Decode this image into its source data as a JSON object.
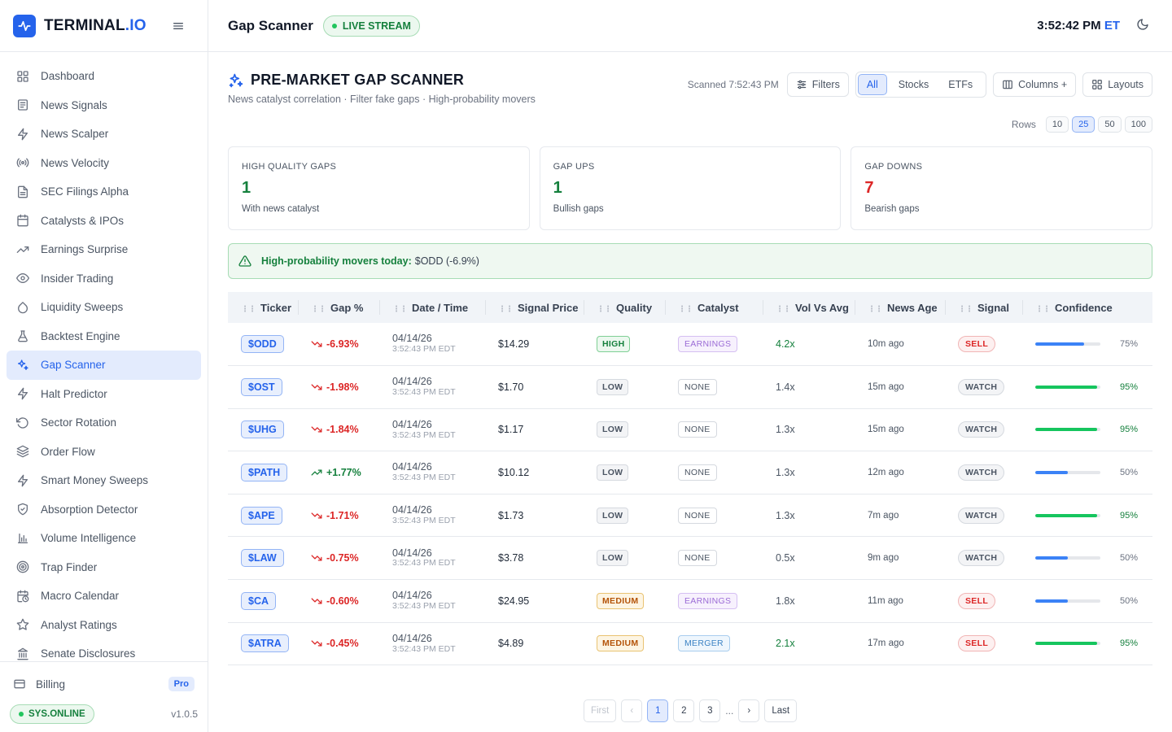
{
  "brand": {
    "name": "TERMINAL",
    "suffix": ".IO"
  },
  "nav": [
    {
      "label": "Dashboard",
      "icon": "dashboard-icon"
    },
    {
      "label": "News Signals",
      "icon": "newspaper-icon"
    },
    {
      "label": "News Scalper",
      "icon": "bolt-icon"
    },
    {
      "label": "News Velocity",
      "icon": "radio-icon"
    },
    {
      "label": "SEC Filings Alpha",
      "icon": "document-icon"
    },
    {
      "label": "Catalysts & IPOs",
      "icon": "calendar-icon"
    },
    {
      "label": "Earnings Surprise",
      "icon": "trending-up-icon"
    },
    {
      "label": "Insider Trading",
      "icon": "eye-icon"
    },
    {
      "label": "Liquidity Sweeps",
      "icon": "droplet-icon"
    },
    {
      "label": "Backtest Engine",
      "icon": "flask-icon"
    },
    {
      "label": "Gap Scanner",
      "icon": "sparkles-icon",
      "active": true
    },
    {
      "label": "Halt Predictor",
      "icon": "bolt-icon"
    },
    {
      "label": "Sector Rotation",
      "icon": "rotate-icon"
    },
    {
      "label": "Order Flow",
      "icon": "layers-icon"
    },
    {
      "label": "Smart Money Sweeps",
      "icon": "bolt-icon"
    },
    {
      "label": "Absorption Detector",
      "icon": "shield-icon"
    },
    {
      "label": "Volume Intelligence",
      "icon": "bar-chart-icon"
    },
    {
      "label": "Trap Finder",
      "icon": "target-icon"
    },
    {
      "label": "Macro Calendar",
      "icon": "calendar-clock-icon"
    },
    {
      "label": "Analyst Ratings",
      "icon": "star-icon"
    },
    {
      "label": "Senate Disclosures",
      "icon": "landmark-icon"
    }
  ],
  "billing": {
    "label": "Billing",
    "badge": "Pro"
  },
  "system": {
    "status": "SYS.ONLINE",
    "version": "v1.0.5"
  },
  "topbar": {
    "title": "Gap Scanner",
    "live": "LIVE STREAM",
    "time": "3:52:42 PM",
    "tz": "ET"
  },
  "page": {
    "title": "PRE-MARKET GAP SCANNER",
    "subtitle": "News catalyst correlation · Filter fake gaps · High-probability movers",
    "scanned": "Scanned 7:52:43 PM",
    "filters_label": "Filters",
    "segments": [
      "All",
      "Stocks",
      "ETFs"
    ],
    "active_segment": "All",
    "columns_label": "Columns +",
    "layouts_label": "Layouts",
    "rows_label": "Rows",
    "rows_options": [
      "10",
      "25",
      "50",
      "100"
    ],
    "rows_selected": "25"
  },
  "cards": [
    {
      "label": "HIGH QUALITY GAPS",
      "value": "1",
      "note": "With news catalyst",
      "tone": "green"
    },
    {
      "label": "GAP UPS",
      "value": "1",
      "note": "Bullish gaps",
      "tone": "green"
    },
    {
      "label": "GAP DOWNS",
      "value": "7",
      "note": "Bearish gaps",
      "tone": "red"
    }
  ],
  "alert": {
    "label": "High-probability movers today:",
    "text": "$ODD (-6.9%)"
  },
  "columns": [
    "Ticker",
    "Gap %",
    "Date / Time",
    "Signal Price",
    "Quality",
    "Catalyst",
    "Vol Vs Avg",
    "News Age",
    "Signal",
    "Confidence"
  ],
  "rows": [
    {
      "ticker": "$ODD",
      "gap": "-6.93%",
      "dir": "down",
      "date": "04/14/26",
      "time": "3:52:43 PM EDT",
      "price": "$14.29",
      "quality": "HIGH",
      "catalyst": "EARNINGS",
      "vol": "4.2x",
      "vol_tone": "green",
      "age": "10m ago",
      "signal": "SELL",
      "confidence": "75%",
      "conf_pct": 0.75,
      "conf_color": "#3b82f6",
      "conf_tone": "#6b7280"
    },
    {
      "ticker": "$OST",
      "gap": "-1.98%",
      "dir": "down",
      "date": "04/14/26",
      "time": "3:52:43 PM EDT",
      "price": "$1.70",
      "quality": "LOW",
      "catalyst": "NONE",
      "vol": "1.4x",
      "vol_tone": "gray",
      "age": "15m ago",
      "signal": "WATCH",
      "confidence": "95%",
      "conf_pct": 0.95,
      "conf_color": "#16c55e",
      "conf_tone": "#15803d"
    },
    {
      "ticker": "$UHG",
      "gap": "-1.84%",
      "dir": "down",
      "date": "04/14/26",
      "time": "3:52:43 PM EDT",
      "price": "$1.17",
      "quality": "LOW",
      "catalyst": "NONE",
      "vol": "1.3x",
      "vol_tone": "gray",
      "age": "15m ago",
      "signal": "WATCH",
      "confidence": "95%",
      "conf_pct": 0.95,
      "conf_color": "#16c55e",
      "conf_tone": "#15803d"
    },
    {
      "ticker": "$PATH",
      "gap": "+1.77%",
      "dir": "up",
      "date": "04/14/26",
      "time": "3:52:43 PM EDT",
      "price": "$10.12",
      "quality": "LOW",
      "catalyst": "NONE",
      "vol": "1.3x",
      "vol_tone": "gray",
      "age": "12m ago",
      "signal": "WATCH",
      "confidence": "50%",
      "conf_pct": 0.5,
      "conf_color": "#3b82f6",
      "conf_tone": "#6b7280"
    },
    {
      "ticker": "$APE",
      "gap": "-1.71%",
      "dir": "down",
      "date": "04/14/26",
      "time": "3:52:43 PM EDT",
      "price": "$1.73",
      "quality": "LOW",
      "catalyst": "NONE",
      "vol": "1.3x",
      "vol_tone": "gray",
      "age": "7m ago",
      "signal": "WATCH",
      "confidence": "95%",
      "conf_pct": 0.95,
      "conf_color": "#16c55e",
      "conf_tone": "#15803d"
    },
    {
      "ticker": "$LAW",
      "gap": "-0.75%",
      "dir": "down",
      "date": "04/14/26",
      "time": "3:52:43 PM EDT",
      "price": "$3.78",
      "quality": "LOW",
      "catalyst": "NONE",
      "vol": "0.5x",
      "vol_tone": "gray",
      "age": "9m ago",
      "signal": "WATCH",
      "confidence": "50%",
      "conf_pct": 0.5,
      "conf_color": "#3b82f6",
      "conf_tone": "#6b7280"
    },
    {
      "ticker": "$CA",
      "gap": "-0.60%",
      "dir": "down",
      "date": "04/14/26",
      "time": "3:52:43 PM EDT",
      "price": "$24.95",
      "quality": "MEDIUM",
      "catalyst": "EARNINGS",
      "vol": "1.8x",
      "vol_tone": "gray",
      "age": "11m ago",
      "signal": "SELL",
      "confidence": "50%",
      "conf_pct": 0.5,
      "conf_color": "#3b82f6",
      "conf_tone": "#6b7280"
    },
    {
      "ticker": "$ATRA",
      "gap": "-0.45%",
      "dir": "down",
      "date": "04/14/26",
      "time": "3:52:43 PM EDT",
      "price": "$4.89",
      "quality": "MEDIUM",
      "catalyst": "MERGER",
      "vol": "2.1x",
      "vol_tone": "green",
      "age": "17m ago",
      "signal": "SELL",
      "confidence": "95%",
      "conf_pct": 0.95,
      "conf_color": "#16c55e",
      "conf_tone": "#15803d"
    }
  ],
  "pagination": {
    "first": "First",
    "last": "Last",
    "pages": [
      "1",
      "2",
      "3"
    ],
    "current": "1",
    "ellipsis": "..."
  }
}
